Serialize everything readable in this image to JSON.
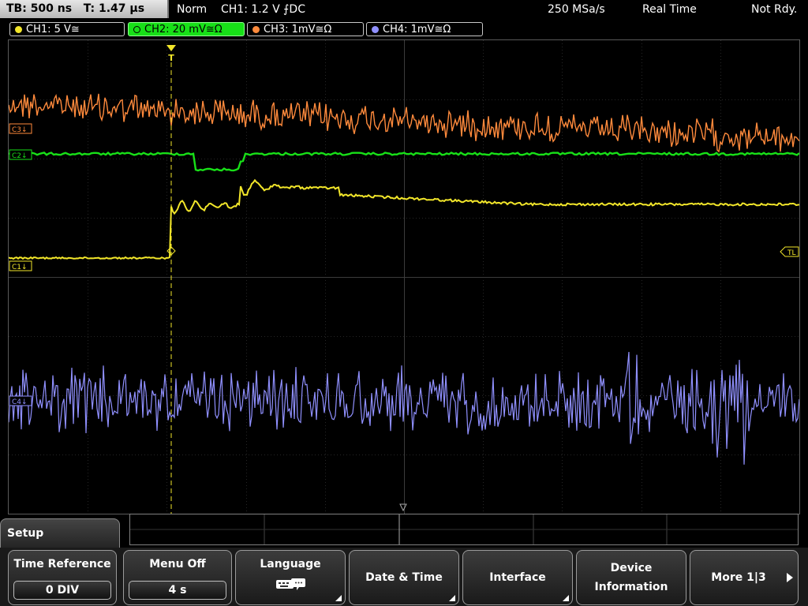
{
  "status": {
    "timebase": "TB: 500 ns",
    "trigger_time": "T: 1.47 µs",
    "mode": "Norm",
    "trigger": "CH1: 1.2 V ⨍DC",
    "sample_rate": "250 MSa/s",
    "acq": "Real Time",
    "state": "Not Rdy."
  },
  "channels": [
    {
      "label": "CH1: 5 V≅",
      "color": "#f2e62a"
    },
    {
      "label": "CH2: 20 mV≅Ω",
      "color": "#18e018"
    },
    {
      "label": "CH3: 1mV≅Ω",
      "color": "#ff8a3c"
    },
    {
      "label": "CH4: 1mV≅Ω",
      "color": "#9090ff"
    }
  ],
  "markers": {
    "c3": "C3↓",
    "c2": "C2↓",
    "c1": "C1↓",
    "c4": "C4↓",
    "trigger_level": "TL",
    "trigger_pos": "T"
  },
  "menu": {
    "title": "Setup",
    "time_reference": {
      "label": "Time Reference",
      "value": "0 DIV"
    },
    "menu_off": {
      "label": "Menu Off",
      "value": "4 s"
    },
    "language": {
      "label": "Language"
    },
    "date_time": {
      "label": "Date & Time"
    },
    "interface": {
      "label": "Interface"
    },
    "device_info": {
      "line1": "Device",
      "line2": "Information"
    },
    "more": {
      "label": "More 1|3"
    }
  },
  "icons": {
    "language": "keyboard-icon",
    "more": "right-arrow-icon",
    "submenu": "submenu-corner-icon"
  }
}
